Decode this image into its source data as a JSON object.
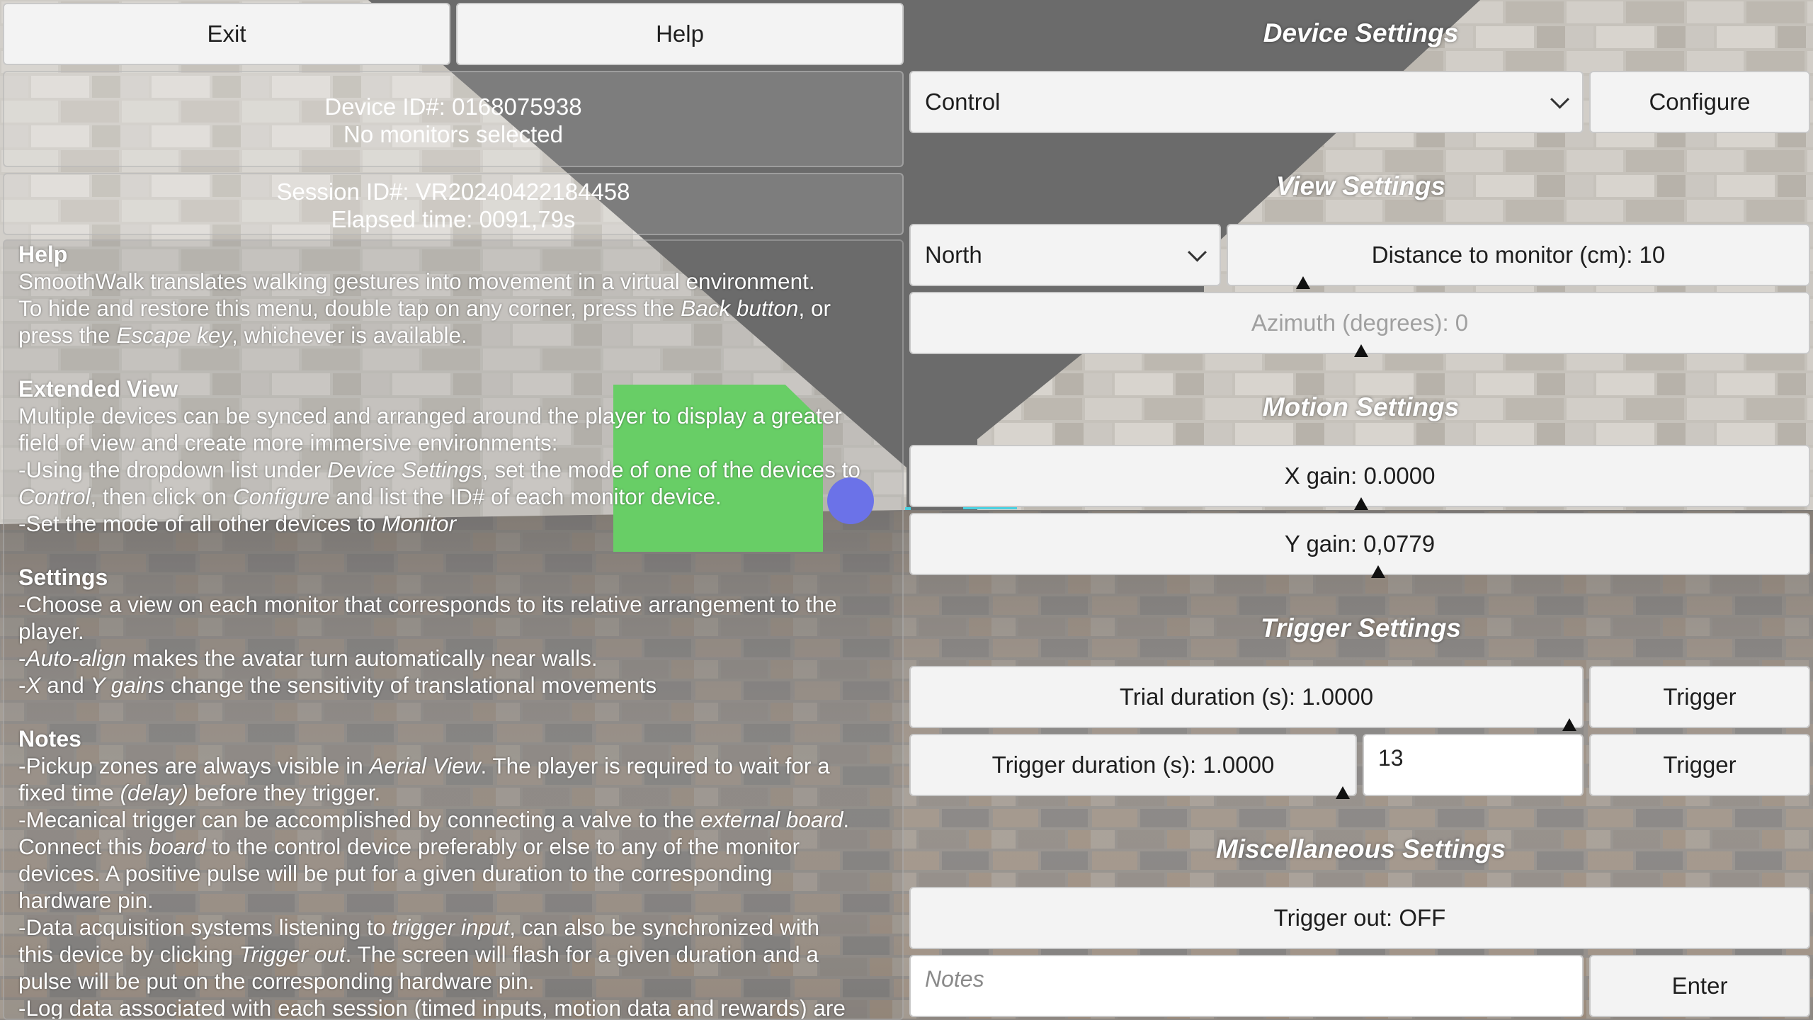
{
  "top": {
    "exit_label": "Exit",
    "help_label": "Help"
  },
  "status": {
    "device_id": "Device ID#: 0168075938",
    "monitors": "No monitors selected",
    "session_id": "Session ID#: VR20240422184458",
    "elapsed": "Elapsed time: 0091,79s"
  },
  "help": {
    "heading_help": "Help",
    "help_l1": "SmoothWalk translates walking gestures into movement in a virtual environment.",
    "help_l2a": "To hide and restore this menu, double tap on any corner, press the ",
    "help_l2b": "Back button",
    "help_l2c": ", or",
    "help_l3a": "press the ",
    "help_l3b": "Escape key",
    "help_l3c": ", whichever is available.",
    "heading_extended": "Extended View",
    "ext_l1": "Multiple devices can be synced and arranged around the player to display a greater",
    "ext_l2": "field of view and create more immersive environments:",
    "ext_l3a": "-Using the dropdown list under ",
    "ext_l3b": "Device Settings",
    "ext_l3c": ", set the mode of one of the devices to",
    "ext_l4a": "Control",
    "ext_l4b": ", then click on ",
    "ext_l4c": "Configure",
    "ext_l4d": " and list the ID# of each monitor device.",
    "ext_l5a": "-Set the mode of all other devices to ",
    "ext_l5b": "Monitor",
    "heading_settings": "Settings",
    "set_l1": "-Choose a view on each monitor that corresponds to its relative arrangement to the",
    "set_l2": "player.",
    "set_l3a": "-",
    "set_l3b": "Auto-align",
    "set_l3c": " makes the avatar turn automatically near walls.",
    "set_l4a": "-",
    "set_l4b": "X",
    "set_l4c": " and ",
    "set_l4d": "Y gains",
    "set_l4e": " change the sensitivity of translational movements",
    "heading_notes": "Notes",
    "n_l1a": "-Pickup zones are always visible in ",
    "n_l1b": "Aerial View",
    "n_l1c": ". The player is required to wait for a",
    "n_l2a": "fixed time ",
    "n_l2b": "(delay)",
    "n_l2c": " before they trigger.",
    "n_l3a": "-Mecanical trigger can be accomplished by connecting a valve to the ",
    "n_l3b": "external board",
    "n_l3c": ".",
    "n_l4a": "Connect this ",
    "n_l4b": "board",
    "n_l4c": " to the control device preferably or else to any of the monitor",
    "n_l5": "devices. A positive pulse will be put for a given duration to the corresponding",
    "n_l6": "hardware pin.",
    "n_l7a": "-Data acquisition systems listening to ",
    "n_l7b": "trigger input",
    "n_l7c": ", can also be synchronized with",
    "n_l8a": "this device by clicking ",
    "n_l8b": "Trigger out",
    "n_l8c": ". The screen will flash for a given duration and a",
    "n_l9": "pulse will be put on the corresponding hardware pin.",
    "n_l10": "-Log data associated with each session (timed inputs, motion data and rewards) are"
  },
  "device_settings": {
    "title": "Device Settings",
    "mode_value": "Control",
    "configure_label": "Configure"
  },
  "view_settings": {
    "title": "View Settings",
    "view_value": "North",
    "distance_label": "Distance to monitor (cm): 10",
    "azimuth_label": "Azimuth (degrees): 0"
  },
  "motion_settings": {
    "title": "Motion Settings",
    "x_gain_label": "X gain: 0.0000",
    "y_gain_label": "Y gain: 0,0779"
  },
  "trigger_settings": {
    "title": "Trigger Settings",
    "trial_duration_label": "Trial duration (s): 1.0000",
    "trigger_button_1": "Trigger",
    "trigger_duration_label": "Trigger duration (s): 1.0000",
    "pin_value": "13",
    "trigger_button_2": "Trigger"
  },
  "misc_settings": {
    "title": "Miscellaneous Settings",
    "trigger_out_label": "Trigger out: OFF",
    "notes_placeholder": "Notes",
    "enter_label": "Enter"
  },
  "colors": {
    "panel": "#f3f3f3",
    "wall": "#c8c4bd",
    "sky": "#6b6b6b",
    "pickup_zone": "#67e364",
    "player_dot": "#6b72e8"
  }
}
